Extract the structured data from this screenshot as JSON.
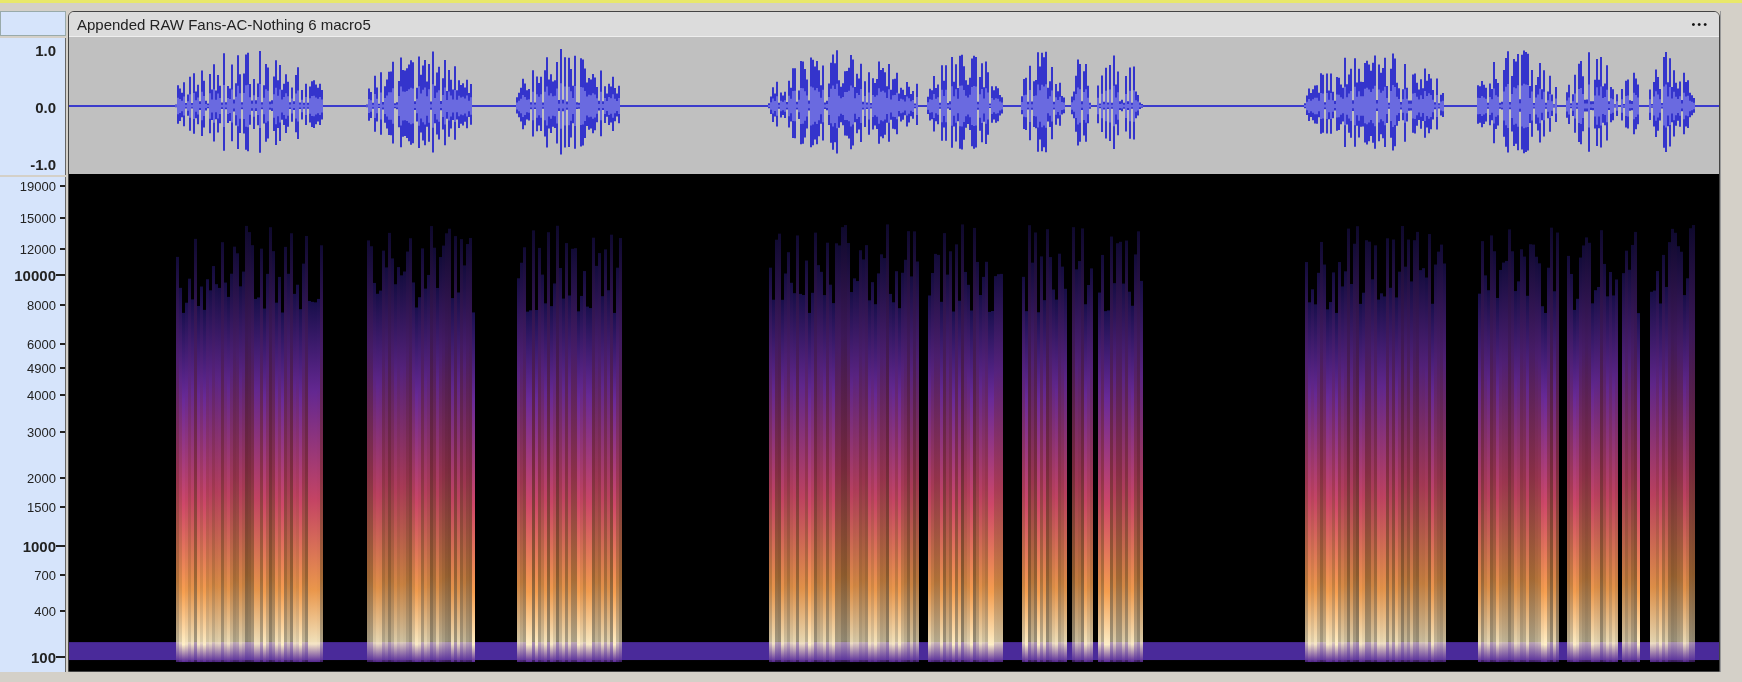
{
  "track": {
    "title": "Appended RAW Fans-AC-Nothing 6 macro5",
    "menu": "•••"
  },
  "waveform_axis": {
    "labels": [
      "1.0",
      "0.0",
      "-1.0"
    ]
  },
  "spectrogram_axis": {
    "labels": [
      {
        "text": "19000",
        "major": false
      },
      {
        "text": "15000",
        "major": false
      },
      {
        "text": "12000",
        "major": false
      },
      {
        "text": "10000",
        "major": true
      },
      {
        "text": "8000",
        "major": false
      },
      {
        "text": "6000",
        "major": false
      },
      {
        "text": "4900",
        "major": false
      },
      {
        "text": "4000",
        "major": false
      },
      {
        "text": "3000",
        "major": false
      },
      {
        "text": "2000",
        "major": false
      },
      {
        "text": "1500",
        "major": false
      },
      {
        "text": "1000",
        "major": true
      },
      {
        "text": "700",
        "major": false
      },
      {
        "text": "400",
        "major": false
      },
      {
        "text": "100",
        "major": true
      }
    ]
  }
}
